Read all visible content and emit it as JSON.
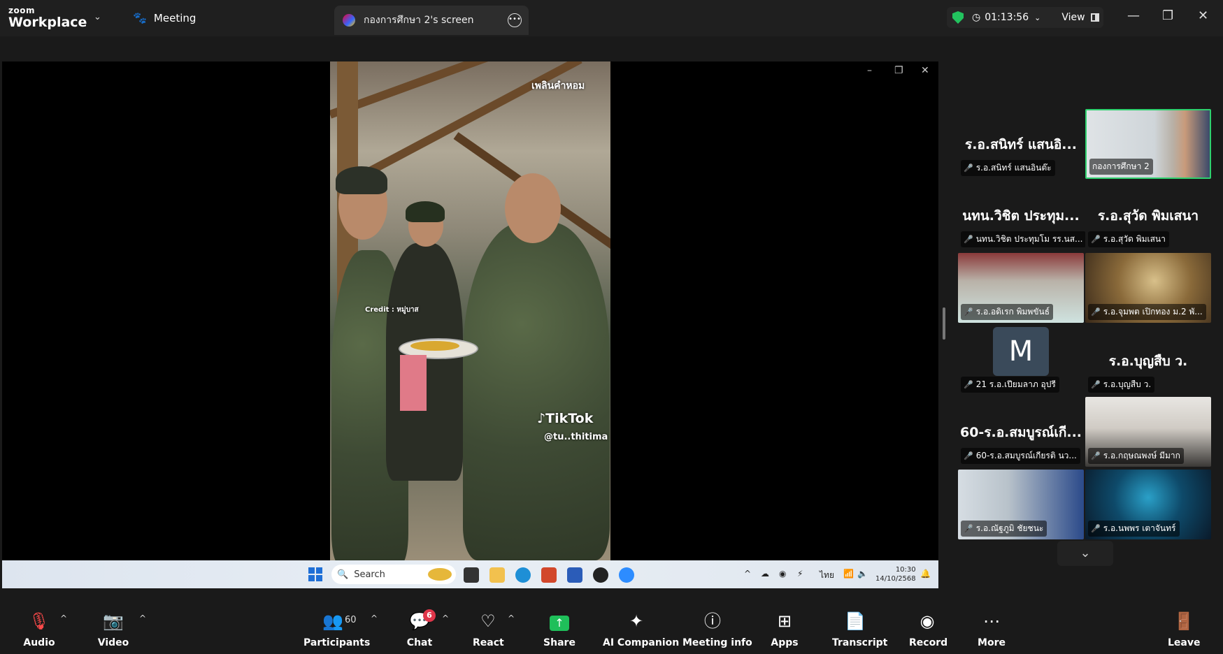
{
  "app": {
    "brand_top": "zoom",
    "brand_bottom": "Workplace"
  },
  "header": {
    "meeting_label": "Meeting",
    "screen_tab": "กองการศึกษา 2's screen",
    "timer": "01:13:56",
    "view_label": "View"
  },
  "video_overlay": {
    "top_caption": "เพลินคำหอม",
    "credit": "Credit : หมู่บาส",
    "tiktok": "TikTok",
    "tiktok_user": "@tu..thitima"
  },
  "taskbar": {
    "search_placeholder": "Search",
    "lang": "ไทย",
    "time": "10:30",
    "date": "14/10/2568"
  },
  "gallery": {
    "tiles": [
      {
        "big": "ร.อ.สนิทร์ แสนอิ...",
        "label": "ร.อ.สนิทร์ แสนอินต๊ะ"
      },
      {
        "big": "",
        "label": "กองการศึกษา 2"
      },
      {
        "big": "นทน.วิชิต ประทุม...",
        "label": "นทน.วิชิต ประทุมโม รร.นส..."
      },
      {
        "big": "ร.อ.สุวัด พิมเสนา",
        "label": "ร.อ.สุวัด พิมเสนา"
      },
      {
        "big": "",
        "label": "ร.อ.อดิเรก  พิมพขันธ์"
      },
      {
        "big": "",
        "label": "ร.อ.จุมพต  เปิกทอง ม.2 พั..."
      },
      {
        "big": "M",
        "label": "21 ร.อ.เปียมลาภ อุปรี"
      },
      {
        "big": "ร.อ.บุญสืบ ว.",
        "label": "ร.อ.บุญสืบ ว."
      },
      {
        "big": "60-ร.อ.สมบูรณ์เกี...",
        "label": "60-ร.อ.สมบูรณ์เกียรติ  นว..."
      },
      {
        "big": "",
        "label": "ร.อ.กฤษณพงษ์ มีมาก"
      },
      {
        "big": "",
        "label": "ร.อ.ณัฐภูมิ ชัยชนะ"
      },
      {
        "big": "",
        "label": "ร.อ.นพพร เตาจันทร์"
      }
    ]
  },
  "toolbar": {
    "audio": "Audio",
    "video": "Video",
    "participants": "Participants",
    "participants_count": "60",
    "chat": "Chat",
    "chat_badge": "6",
    "react": "React",
    "share": "Share",
    "ai": "AI Companion",
    "info": "Meeting info",
    "apps": "Apps",
    "transcript": "Transcript",
    "record": "Record",
    "more": "More",
    "leave": "Leave"
  }
}
